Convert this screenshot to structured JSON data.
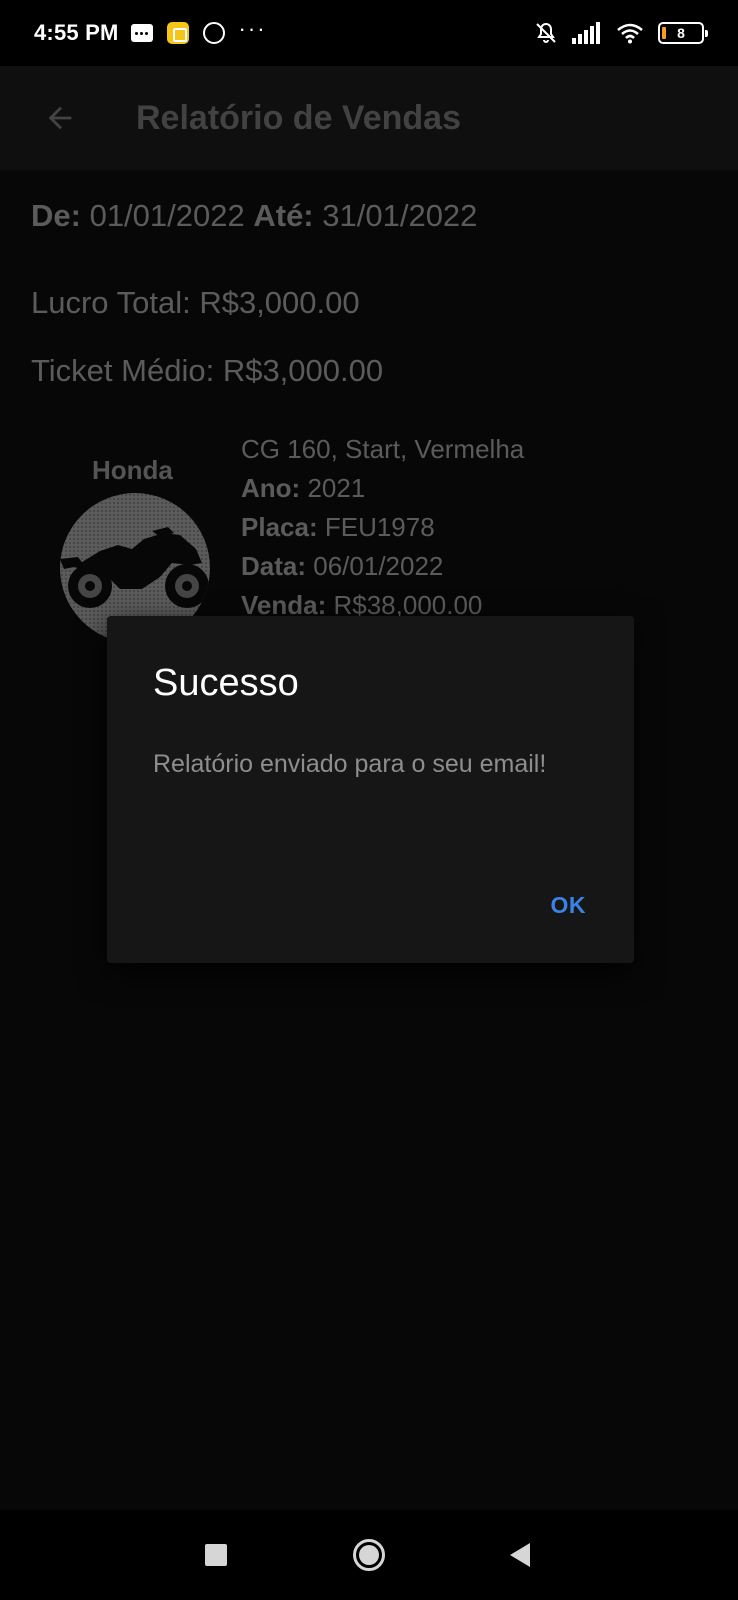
{
  "status_bar": {
    "time": "4:55 PM",
    "dots": "···",
    "battery_level": "8",
    "icons": [
      "sms-icon",
      "app-notification-icon",
      "whatsapp-icon",
      "bell-off-icon",
      "signal-icon",
      "wifi-icon",
      "battery-icon"
    ]
  },
  "app_bar": {
    "title": "Relatório de Vendas",
    "back_icon": "arrow-left-icon"
  },
  "report": {
    "period": {
      "from_label": "De:",
      "from_value": "01/01/2022",
      "to_label": "Até:",
      "to_value": "31/01/2022"
    },
    "total_profit": {
      "label": "Lucro Total:",
      "value": "R$3,000.00"
    },
    "average_ticket": {
      "label": "Ticket Médio:",
      "value": "R$3,000.00"
    }
  },
  "sales": [
    {
      "brand": "Honda",
      "thumbnail_icon": "motorcycle-icon",
      "description": "CG 160, Start, Vermelha",
      "year_label": "Ano:",
      "year": "2021",
      "plate_label": "Placa:",
      "plate": "FEU1978",
      "date_label": "Data:",
      "date": "06/01/2022",
      "sale_label": "Venda:",
      "sale": "R$38,000.00"
    }
  ],
  "dialog": {
    "title": "Sucesso",
    "message": "Relatório enviado para o seu email!",
    "ok_label": "OK",
    "accent_color": "#3b82e6"
  },
  "nav_bar": {
    "icons": [
      "recents-icon",
      "home-icon",
      "back-icon"
    ]
  }
}
